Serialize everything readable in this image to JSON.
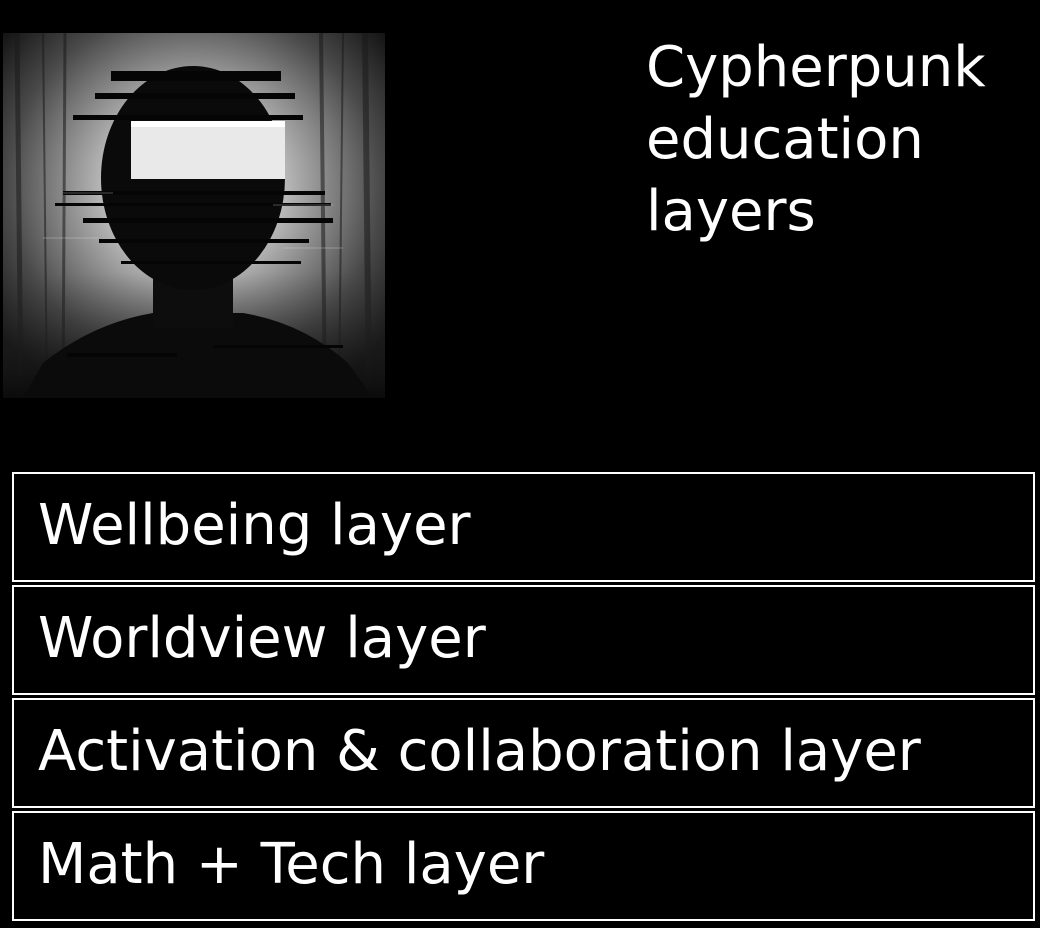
{
  "title": "Cypherpunk\neducation\nlayers",
  "image": {
    "subject": "glitched-faceless-portrait",
    "style": "monochrome"
  },
  "layers": [
    {
      "label": "Wellbeing layer"
    },
    {
      "label": "Worldview layer"
    },
    {
      "label": "Activation & collaboration layer"
    },
    {
      "label": "Math + Tech layer"
    }
  ],
  "colors": {
    "background": "#000000",
    "text": "#ffffff",
    "border": "#ffffff"
  }
}
